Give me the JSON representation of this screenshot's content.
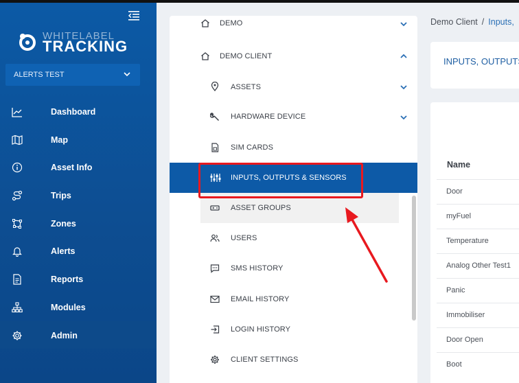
{
  "brand": {
    "line1": "WHITELABEL",
    "line2": "TRACKING"
  },
  "client_select": {
    "value": "ALERTS TEST"
  },
  "sidebar": {
    "items": [
      {
        "label": "Dashboard",
        "icon": "chart-line-icon"
      },
      {
        "label": "Map",
        "icon": "map-icon"
      },
      {
        "label": "Asset Info",
        "icon": "info-icon"
      },
      {
        "label": "Trips",
        "icon": "route-icon"
      },
      {
        "label": "Zones",
        "icon": "zone-icon"
      },
      {
        "label": "Alerts",
        "icon": "bell-icon"
      },
      {
        "label": "Reports",
        "icon": "document-icon"
      },
      {
        "label": "Modules",
        "icon": "sitemap-icon"
      },
      {
        "label": "Admin",
        "icon": "gear-icon"
      }
    ]
  },
  "menu": {
    "items": [
      {
        "label": "DEMO",
        "icon": "home-icon"
      },
      {
        "label": "DEMO CLIENT",
        "icon": "home-icon"
      },
      {
        "label": "ASSETS",
        "icon": "location-pin-icon"
      },
      {
        "label": "HARDWARE DEVICE",
        "icon": "wrench-icon"
      },
      {
        "label": "SIM CARDS",
        "icon": "sim-card-icon"
      },
      {
        "label": "INPUTS, OUTPUTS & SENSORS",
        "icon": "sensors-icon"
      },
      {
        "label": "ASSET GROUPS",
        "icon": "asset-groups-icon"
      },
      {
        "label": "USERS",
        "icon": "users-icon"
      },
      {
        "label": "SMS HISTORY",
        "icon": "sms-icon"
      },
      {
        "label": "EMAIL HISTORY",
        "icon": "email-icon"
      },
      {
        "label": "LOGIN HISTORY",
        "icon": "login-icon"
      },
      {
        "label": "CLIENT SETTINGS",
        "icon": "gear-icon"
      }
    ]
  },
  "breadcrumb": {
    "first": "Demo Client",
    "separator": "/",
    "second": "Inputs,"
  },
  "page_title": "INPUTS, OUTPUTS",
  "table": {
    "header": "Name",
    "rows": [
      "Door",
      "myFuel",
      "Temperature",
      "Analog Other Test1",
      "Panic",
      "Immobiliser",
      "Door Open",
      "Boot"
    ]
  },
  "colors": {
    "sidebar": "#0c5aa6",
    "selected": "#0d5aa7",
    "annotation": "#e8191f"
  }
}
